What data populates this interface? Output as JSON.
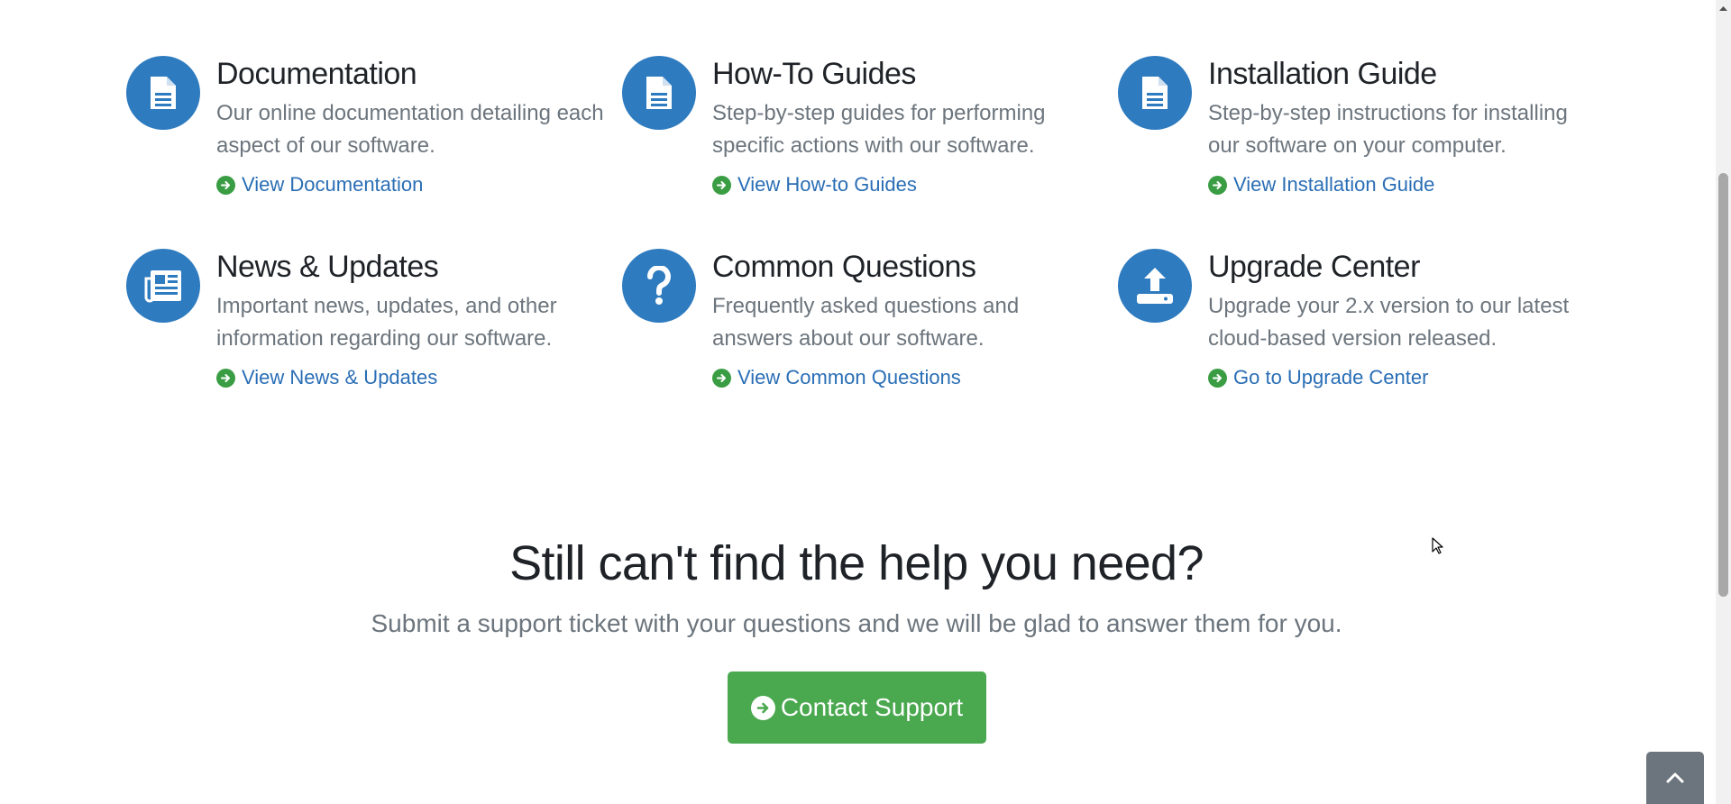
{
  "resources": [
    {
      "icon": "document-icon",
      "title": "Documentation",
      "description": "Our online documentation detailing each aspect of our software.",
      "link": "View Documentation"
    },
    {
      "icon": "document-icon",
      "title": "How-To Guides",
      "description": "Step-by-step guides for performing specific actions with our software.",
      "link": "View How-to Guides"
    },
    {
      "icon": "document-icon",
      "title": "Installation Guide",
      "description": "Step-by-step instructions for installing our software on your computer.",
      "link": "View Installation Guide"
    },
    {
      "icon": "newspaper-icon",
      "title": "News & Updates",
      "description": "Important news, updates, and other information regarding our software.",
      "link": "View News & Updates"
    },
    {
      "icon": "question-icon",
      "title": "Common Questions",
      "description": "Frequently asked questions and answers about our software.",
      "link": "View Common Questions"
    },
    {
      "icon": "upload-icon",
      "title": "Upgrade Center",
      "description": "Upgrade your 2.x version to our latest cloud-based version released.",
      "link": "Go to Upgrade Center"
    }
  ],
  "help": {
    "title": "Still can't find the help you need?",
    "subtitle": "Submit a support ticket with your questions and we will be glad to answer them for you.",
    "button_label": "Contact Support"
  },
  "colors": {
    "icon_blue": "#2e7bbf",
    "link_blue": "#2a6eb5",
    "accent_green": "#4aa84f"
  },
  "widgets": {
    "scroll_top_icon": "chevron-up-icon",
    "scrollbar_up_icon": "scroll-up-arrow-icon"
  }
}
